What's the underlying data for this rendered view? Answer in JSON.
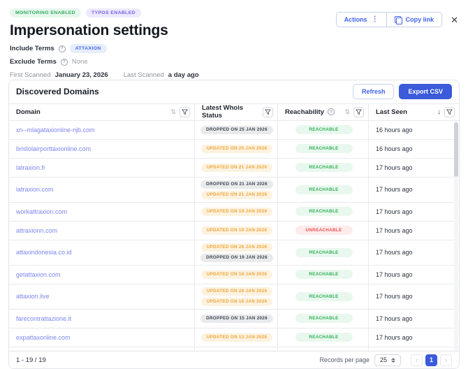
{
  "colors": {
    "blue": "#4263eb",
    "blue_solid": "#3b5bdb",
    "blue_bg": "#e6edfb",
    "green": "#2eac5b",
    "green_bg": "#e7f7ed",
    "purple": "#7a5cf0",
    "purple_bg": "#eceafc",
    "orange": "#efa63c",
    "orange_bg": "#fcf2df",
    "ok": "#31b057",
    "ok_bg": "#e9f8ee",
    "bad": "#e8535a",
    "bad_bg": "#fdeceb",
    "domain_link": "#7e85ee"
  },
  "header": {
    "badges": [
      {
        "label": "MONITORING ENABLED",
        "type": "green"
      },
      {
        "label": "TYPOS ENABLED",
        "type": "purple"
      }
    ],
    "title": "Impersonation settings",
    "actions_button": "Actions",
    "copy_link_button": "Copy link",
    "include_terms_label": "Include Terms",
    "include_terms": [
      {
        "label": "ATTAXION"
      }
    ],
    "exclude_terms_label": "Exclude Terms",
    "exclude_terms_value": "None",
    "first_scanned_label": "First Scanned",
    "first_scanned_value": "January 23, 2026",
    "last_scanned_label": "Last Scanned",
    "last_scanned_value": "a day ago"
  },
  "table": {
    "title": "Discovered Domains",
    "refresh_button": "Refresh",
    "export_button": "Export CSV",
    "columns": [
      {
        "label": "Domain"
      },
      {
        "label": "Latest Whois Status"
      },
      {
        "label": "Reachability"
      },
      {
        "label": "Last Seen"
      }
    ],
    "rows": [
      {
        "domain": "xn--mlagataxionline-njb.com",
        "whois": [
          {
            "text": "DROPPED ON 25 JAN 2026",
            "type": "gray"
          }
        ],
        "reachability": "REACHABLE",
        "reach_type": "green",
        "last_seen": "16 hours ago"
      },
      {
        "domain": "bristolairporttaxionline.com",
        "whois": [
          {
            "text": "UPDATED ON 25 JAN 2026",
            "type": "orange"
          }
        ],
        "reachability": "REACHABLE",
        "reach_type": "green",
        "last_seen": "16 hours ago"
      },
      {
        "domain": "latraxion.fr",
        "whois": [
          {
            "text": "UPDATED ON 21 JAN 2026",
            "type": "orange"
          }
        ],
        "reachability": "REACHABLE",
        "reach_type": "green",
        "last_seen": "17 hours ago"
      },
      {
        "domain": "latraxion.com",
        "whois": [
          {
            "text": "DROPPED ON 21 JAN 2026",
            "type": "gray"
          },
          {
            "text": "UPDATED ON 21 JAN 2026",
            "type": "orange"
          }
        ],
        "reachability": "REACHABLE",
        "reach_type": "green",
        "last_seen": "17 hours ago"
      },
      {
        "domain": "workattraxion.com",
        "whois": [
          {
            "text": "UPDATED ON 19 JAN 2026",
            "type": "orange"
          }
        ],
        "reachability": "REACHABLE",
        "reach_type": "green",
        "last_seen": "17 hours ago"
      },
      {
        "domain": "attraxionn.com",
        "whois": [
          {
            "text": "UPDATED ON 19 JAN 2026",
            "type": "orange"
          }
        ],
        "reachability": "UNREACHABLE",
        "reach_type": "red",
        "last_seen": "17 hours ago"
      },
      {
        "domain": "attaxindonesia.co.id",
        "whois": [
          {
            "text": "UPDATED ON 26 JAN 2026",
            "type": "orange"
          },
          {
            "text": "DROPPED ON 19 JAN 2026",
            "type": "gray"
          }
        ],
        "reachability": "REACHABLE",
        "reach_type": "green",
        "last_seen": "17 hours ago"
      },
      {
        "domain": "getattaxion.com",
        "whois": [
          {
            "text": "UPDATED ON 18 JAN 2026",
            "type": "orange"
          }
        ],
        "reachability": "REACHABLE",
        "reach_type": "green",
        "last_seen": "17 hours ago"
      },
      {
        "domain": "attaxion.live",
        "whois": [
          {
            "text": "UPDATED ON 26 JAN 2026",
            "type": "orange"
          },
          {
            "text": "UPDATED ON 16 JAN 2026",
            "type": "orange"
          }
        ],
        "reachability": "REACHABLE",
        "reach_type": "green",
        "last_seen": "17 hours ago"
      },
      {
        "domain": "farecontrattazione.it",
        "whois": [
          {
            "text": "DROPPED ON 15 JAN 2026",
            "type": "gray"
          }
        ],
        "reachability": "REACHABLE",
        "reach_type": "green",
        "last_seen": "17 hours ago"
      },
      {
        "domain": "expattaxonline.com",
        "whois": [
          {
            "text": "UPDATED ON 13 JAN 2026",
            "type": "orange"
          }
        ],
        "reachability": "REACHABLE",
        "reach_type": "green",
        "last_seen": "17 hours ago"
      }
    ]
  },
  "footer": {
    "range": "1 - 19 / 19",
    "records_per_page_label": "Records per page",
    "records_per_page_value": "25",
    "page": "1",
    "prev": "‹",
    "next": "›"
  }
}
